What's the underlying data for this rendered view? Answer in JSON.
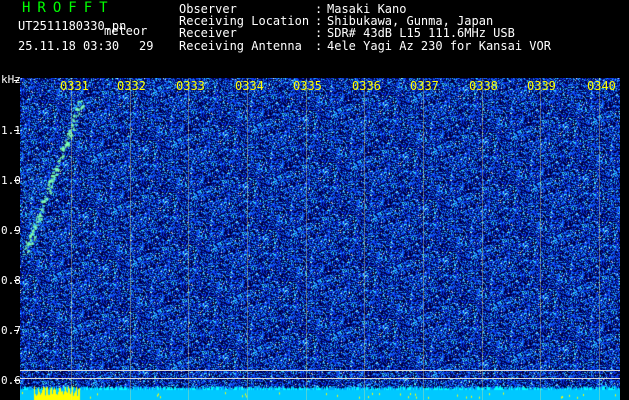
{
  "header": {
    "title": "HROFFT",
    "filename": "UT2511180330.pn",
    "tag": "meteor",
    "datetime": "25.11.18 03:30",
    "count": "29"
  },
  "meta": {
    "rows": [
      {
        "label": "Observer",
        "sep": ":",
        "value": "Masaki Kano"
      },
      {
        "label": "Receiving Location",
        "sep": ":",
        "value": "Shibukawa, Gunma, Japan"
      },
      {
        "label": "Receiver",
        "sep": ":",
        "value": "SDR# 43dB L15 111.6MHz USB"
      },
      {
        "label": "Receiving Antenna",
        "sep": ":",
        "value": "4ele Yagi Az 230 for Kansai VOR"
      }
    ]
  },
  "axis": {
    "y_unit": "kHz",
    "y_ticks": [
      "1.1",
      "1.0",
      "0.9",
      "0.8",
      "0.7",
      "0.6"
    ],
    "x_ticks": [
      "0331",
      "0332",
      "0333",
      "0334",
      "0335",
      "0336",
      "0337",
      "0338",
      "0339",
      "0340"
    ]
  },
  "colors": {
    "background": "#000000",
    "noise": "#1a3cff",
    "bright": "#00ffff",
    "peak": "#ffff00",
    "title": "#00ff00",
    "tick_label": "#ffff00"
  }
}
